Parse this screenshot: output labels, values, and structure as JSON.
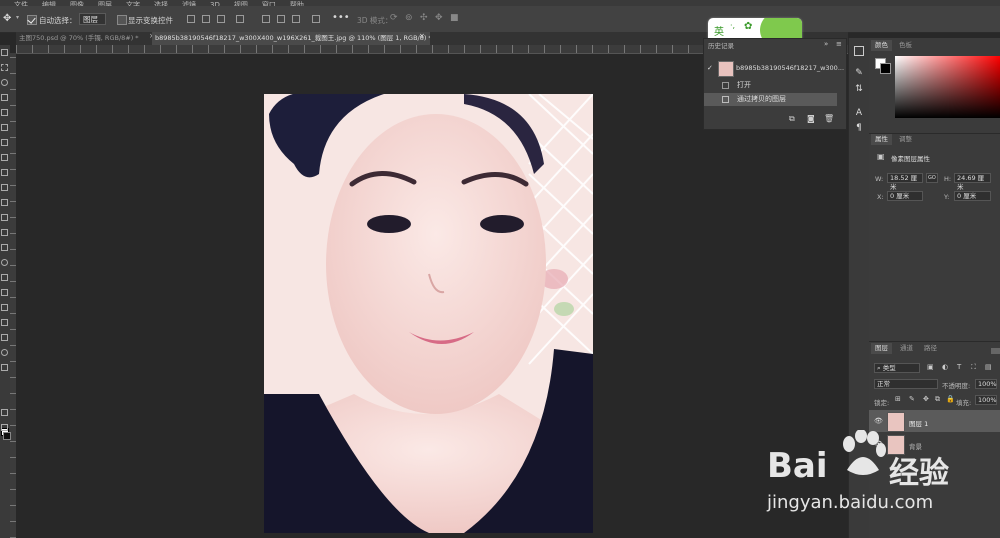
{
  "menu": [
    "文件",
    "编辑",
    "图像",
    "图层",
    "文字",
    "选择",
    "滤镜",
    "3D",
    "视图",
    "窗口",
    "帮助"
  ],
  "options": {
    "auto_select_label": "自动选择：",
    "layer_select_value": "图层",
    "show_transform_label": "显示变换控件",
    "mode_3d_label": "3D 模式："
  },
  "tabs": [
    {
      "label": "主图750.psd @ 70% (手镯, RGB/8#) *",
      "close": "×"
    },
    {
      "label": "b8985b38190546f18217_w300X400_w196X261_裁图王.jpg @ 110% (图层 1, RGB/8) *",
      "close": "×"
    }
  ],
  "ime": {
    "label": "英"
  },
  "history": {
    "title": "历史记录",
    "snapshot": "b8985b38190546f18217_w300...",
    "items": [
      "打开",
      "通过拷贝的图层"
    ]
  },
  "color_panel": {
    "tab1": "颜色",
    "tab2": "色板"
  },
  "properties": {
    "tab1": "属性",
    "tab2": "调整",
    "type_label": "像素图层属性",
    "w_label": "W:",
    "w_value": "18.52 厘米",
    "link_label": "GO",
    "h_label": "H:",
    "h_value": "24.69 厘米",
    "x_label": "X:",
    "x_value": "0 厘米",
    "y_label": "Y:",
    "y_value": "0 厘米"
  },
  "layers_panel": {
    "tab1": "图层",
    "tab2": "通道",
    "tab3": "路径",
    "filter_value": "类型",
    "blend_mode": "正常",
    "opacity_label": "不透明度:",
    "opacity_value": "100%",
    "lock_label": "锁定:",
    "fill_label": "填充:",
    "fill_value": "100%",
    "layers": [
      {
        "name": "图层 1"
      },
      {
        "name": "背景"
      }
    ]
  },
  "watermark": {
    "brand1": "Bai",
    "brand2": "经验",
    "url": "jingyan.baidu.com"
  },
  "colors": {
    "accent_red": "#ff0000",
    "panel_bg": "#3b3b3b",
    "workspace": "#282828"
  }
}
